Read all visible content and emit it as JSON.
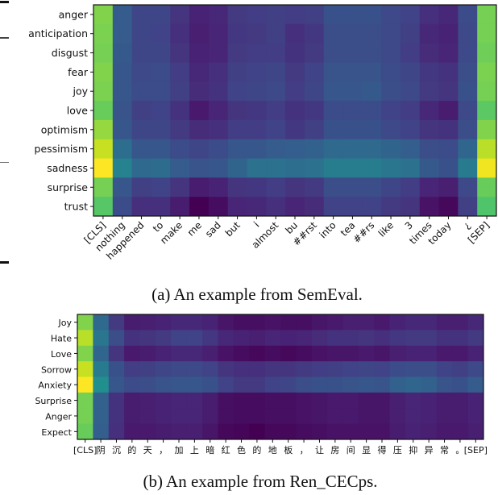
{
  "chart_data": [
    {
      "type": "heatmap",
      "title": "",
      "caption": "(a) An example from SemEval.",
      "colormap": "viridis",
      "vrange": [
        0,
        1
      ],
      "rows": [
        "anger",
        "anticipation",
        "disgust",
        "fear",
        "joy",
        "love",
        "optimism",
        "pessimism",
        "sadness",
        "surprise",
        "trust"
      ],
      "columns": [
        "[CLS]",
        "nothing",
        "happened",
        "to",
        "make",
        "me",
        "sad",
        "but",
        "i",
        "almost",
        "bu",
        "##rst",
        "into",
        "tea",
        "##rs",
        "like",
        "3",
        "times",
        "today",
        "¿",
        "[SEP]"
      ],
      "values": [
        [
          0.82,
          0.3,
          0.22,
          0.22,
          0.16,
          0.1,
          0.12,
          0.18,
          0.19,
          0.2,
          0.19,
          0.2,
          0.26,
          0.26,
          0.26,
          0.23,
          0.21,
          0.14,
          0.12,
          0.24,
          0.8
        ],
        [
          0.81,
          0.3,
          0.22,
          0.21,
          0.14,
          0.09,
          0.11,
          0.17,
          0.18,
          0.2,
          0.14,
          0.17,
          0.25,
          0.25,
          0.25,
          0.23,
          0.2,
          0.12,
          0.1,
          0.23,
          0.8
        ],
        [
          0.8,
          0.29,
          0.22,
          0.22,
          0.16,
          0.1,
          0.11,
          0.18,
          0.19,
          0.19,
          0.15,
          0.18,
          0.25,
          0.25,
          0.25,
          0.23,
          0.19,
          0.13,
          0.11,
          0.23,
          0.79
        ],
        [
          0.82,
          0.28,
          0.23,
          0.24,
          0.19,
          0.12,
          0.14,
          0.2,
          0.21,
          0.22,
          0.18,
          0.21,
          0.27,
          0.27,
          0.27,
          0.24,
          0.22,
          0.17,
          0.15,
          0.25,
          0.81
        ],
        [
          0.81,
          0.28,
          0.24,
          0.24,
          0.2,
          0.13,
          0.15,
          0.21,
          0.22,
          0.23,
          0.19,
          0.22,
          0.28,
          0.28,
          0.29,
          0.25,
          0.23,
          0.18,
          0.16,
          0.26,
          0.8
        ],
        [
          0.78,
          0.27,
          0.2,
          0.21,
          0.15,
          0.07,
          0.11,
          0.16,
          0.17,
          0.19,
          0.15,
          0.17,
          0.24,
          0.24,
          0.24,
          0.21,
          0.19,
          0.12,
          0.08,
          0.23,
          0.76
        ],
        [
          0.85,
          0.28,
          0.22,
          0.22,
          0.18,
          0.13,
          0.14,
          0.19,
          0.19,
          0.21,
          0.17,
          0.2,
          0.26,
          0.26,
          0.26,
          0.23,
          0.21,
          0.16,
          0.15,
          0.25,
          0.82
        ],
        [
          0.92,
          0.37,
          0.28,
          0.28,
          0.24,
          0.22,
          0.24,
          0.28,
          0.28,
          0.3,
          0.31,
          0.32,
          0.35,
          0.35,
          0.35,
          0.33,
          0.31,
          0.25,
          0.24,
          0.34,
          0.9
        ],
        [
          1.0,
          0.45,
          0.35,
          0.36,
          0.3,
          0.27,
          0.28,
          0.33,
          0.38,
          0.38,
          0.37,
          0.38,
          0.43,
          0.43,
          0.43,
          0.4,
          0.38,
          0.29,
          0.26,
          0.42,
          0.98
        ],
        [
          0.8,
          0.28,
          0.2,
          0.21,
          0.16,
          0.08,
          0.1,
          0.16,
          0.17,
          0.19,
          0.16,
          0.18,
          0.25,
          0.25,
          0.25,
          0.22,
          0.19,
          0.11,
          0.09,
          0.23,
          0.78
        ],
        [
          0.75,
          0.24,
          0.14,
          0.14,
          0.08,
          0.0,
          0.03,
          0.11,
          0.12,
          0.14,
          0.11,
          0.13,
          0.21,
          0.21,
          0.21,
          0.18,
          0.16,
          0.05,
          0.02,
          0.2,
          0.74
        ]
      ]
    },
    {
      "type": "heatmap",
      "title": "",
      "caption": "(b) An example from Ren_CECps.",
      "colormap": "viridis",
      "vrange": [
        0,
        1
      ],
      "rows": [
        "Joy",
        "Hate",
        "Love",
        "Sorrow",
        "Anxiety",
        "Surprise",
        "Anger",
        "Expect"
      ],
      "columns": [
        "[CLS]",
        "阴",
        "沉",
        "的",
        "天",
        "，",
        "加",
        "上",
        "暗",
        "红",
        "色",
        "的",
        "地",
        "板",
        "，",
        "让",
        "房",
        "间",
        "显",
        "得",
        "压",
        "抑",
        "异",
        "常",
        "。",
        "[SEP]"
      ],
      "values": [
        [
          0.82,
          0.35,
          0.18,
          0.08,
          0.09,
          0.1,
          0.12,
          0.12,
          0.1,
          0.06,
          0.04,
          0.04,
          0.05,
          0.04,
          0.04,
          0.06,
          0.07,
          0.09,
          0.09,
          0.07,
          0.1,
          0.12,
          0.12,
          0.09,
          0.09,
          0.12
        ],
        [
          0.9,
          0.4,
          0.25,
          0.15,
          0.16,
          0.18,
          0.21,
          0.21,
          0.17,
          0.12,
          0.1,
          0.09,
          0.11,
          0.1,
          0.11,
          0.13,
          0.15,
          0.15,
          0.16,
          0.14,
          0.17,
          0.18,
          0.18,
          0.15,
          0.15,
          0.18
        ],
        [
          0.82,
          0.34,
          0.16,
          0.07,
          0.08,
          0.1,
          0.12,
          0.12,
          0.09,
          0.05,
          0.03,
          0.02,
          0.03,
          0.02,
          0.03,
          0.05,
          0.06,
          0.06,
          0.07,
          0.06,
          0.09,
          0.1,
          0.1,
          0.07,
          0.07,
          0.1
        ],
        [
          0.92,
          0.42,
          0.26,
          0.19,
          0.2,
          0.22,
          0.23,
          0.23,
          0.21,
          0.16,
          0.14,
          0.14,
          0.16,
          0.16,
          0.18,
          0.19,
          0.2,
          0.21,
          0.22,
          0.21,
          0.24,
          0.25,
          0.25,
          0.21,
          0.2,
          0.23
        ],
        [
          1.0,
          0.5,
          0.28,
          0.24,
          0.25,
          0.27,
          0.28,
          0.28,
          0.26,
          0.21,
          0.18,
          0.18,
          0.21,
          0.22,
          0.25,
          0.26,
          0.26,
          0.27,
          0.28,
          0.27,
          0.32,
          0.34,
          0.32,
          0.27,
          0.26,
          0.3
        ],
        [
          0.8,
          0.32,
          0.15,
          0.08,
          0.09,
          0.1,
          0.11,
          0.11,
          0.08,
          0.04,
          0.03,
          0.03,
          0.04,
          0.04,
          0.05,
          0.06,
          0.07,
          0.07,
          0.06,
          0.06,
          0.09,
          0.11,
          0.1,
          0.08,
          0.08,
          0.1
        ],
        [
          0.8,
          0.32,
          0.15,
          0.08,
          0.09,
          0.1,
          0.11,
          0.11,
          0.08,
          0.04,
          0.03,
          0.03,
          0.04,
          0.04,
          0.05,
          0.06,
          0.07,
          0.07,
          0.06,
          0.06,
          0.09,
          0.11,
          0.1,
          0.08,
          0.08,
          0.1
        ],
        [
          0.78,
          0.31,
          0.14,
          0.07,
          0.07,
          0.08,
          0.09,
          0.09,
          0.06,
          0.02,
          0.01,
          0.0,
          0.02,
          0.02,
          0.03,
          0.04,
          0.05,
          0.05,
          0.05,
          0.05,
          0.08,
          0.1,
          0.09,
          0.07,
          0.07,
          0.09
        ]
      ]
    }
  ]
}
